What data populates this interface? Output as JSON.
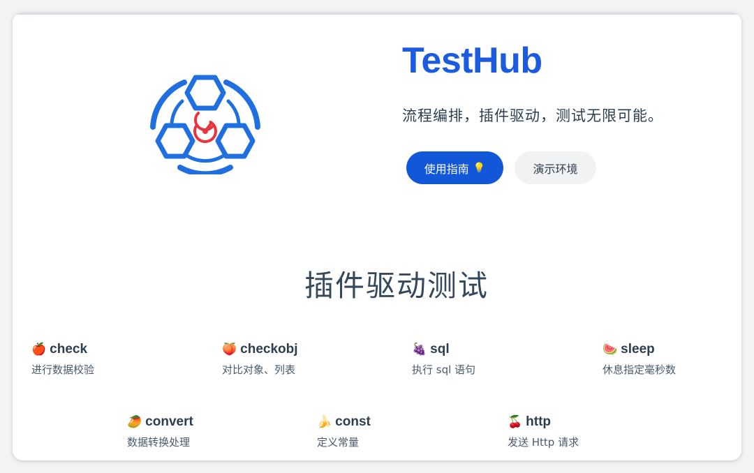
{
  "hero": {
    "title": "TestHub",
    "tagline": "流程编排，插件驱动，测试无限可能。",
    "primary_button": {
      "label": "使用指南",
      "icon": "💡"
    },
    "secondary_button": {
      "label": "演示环境"
    },
    "logo_colors": {
      "blue": "#1f6fe0",
      "red": "#e8343f"
    }
  },
  "section": {
    "title": "插件驱动测试"
  },
  "features": [
    {
      "emoji": "🍎",
      "name": "check",
      "desc": "进行数据校验"
    },
    {
      "emoji": "🍑",
      "name": "checkobj",
      "desc": "对比对象、列表"
    },
    {
      "emoji": "🍇",
      "name": "sql",
      "desc": "执行 sql 语句"
    },
    {
      "emoji": "🍉",
      "name": "sleep",
      "desc": "休息指定毫秒数"
    },
    {
      "emoji": "🥭",
      "name": "convert",
      "desc": "数据转换处理"
    },
    {
      "emoji": "🍌",
      "name": "const",
      "desc": "定义常量"
    },
    {
      "emoji": "🍒",
      "name": "http",
      "desc": "发送 Http 请求"
    }
  ],
  "colors": {
    "brand": "#1b5be0",
    "primary_button": "#1257d8",
    "text": "#2c3e50"
  }
}
